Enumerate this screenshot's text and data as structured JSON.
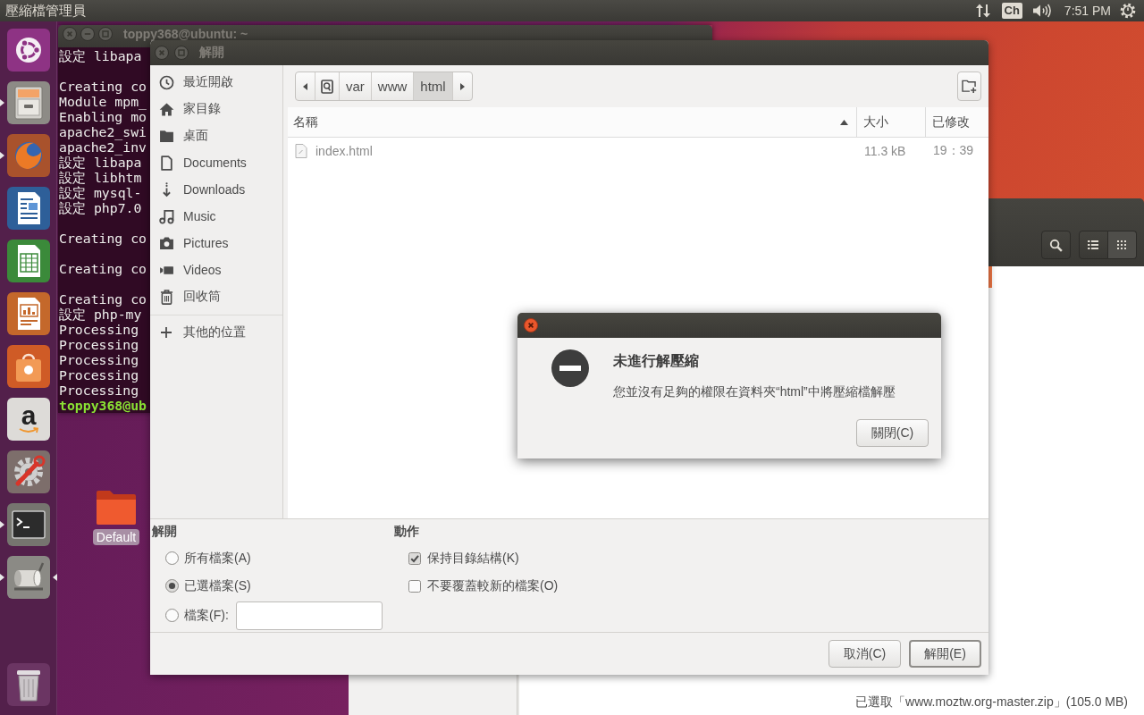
{
  "top_panel": {
    "app_title": "壓縮檔管理員",
    "keyboard_layout": "Ch",
    "clock": "7:51 PM"
  },
  "launcher": {
    "items": [
      {
        "kind": "dash",
        "running": false,
        "focused": false
      },
      {
        "kind": "files",
        "running": true,
        "focused": false
      },
      {
        "kind": "browser",
        "running": true,
        "focused": false
      },
      {
        "kind": "writer",
        "running": false,
        "focused": false
      },
      {
        "kind": "calc",
        "running": false,
        "focused": false
      },
      {
        "kind": "impress",
        "running": false,
        "focused": false
      },
      {
        "kind": "software",
        "running": false,
        "focused": false
      },
      {
        "kind": "store",
        "glyph": "a",
        "running": false,
        "focused": false
      },
      {
        "kind": "settings",
        "running": false,
        "focused": false
      },
      {
        "kind": "terminal",
        "running": true,
        "focused": false
      },
      {
        "kind": "archiver",
        "running": true,
        "focused": true
      }
    ],
    "bottom_items": [
      {
        "kind": "trash",
        "running": false,
        "focused": false
      }
    ]
  },
  "desktop_icons": [
    {
      "label": "Default"
    }
  ],
  "terminal": {
    "title": "toppy368@ubuntu: ~",
    "active": false,
    "lines": [
      {
        "kind": "output",
        "text": "設定 libapa"
      },
      {
        "kind": "blank"
      },
      {
        "kind": "output",
        "text": "Creating co"
      },
      {
        "kind": "output",
        "text": "Module mpm_"
      },
      {
        "kind": "output",
        "text": "Enabling mo"
      },
      {
        "kind": "output",
        "text": "apache2_swi"
      },
      {
        "kind": "output",
        "text": "apache2_inv"
      },
      {
        "kind": "output",
        "text": "設定 libapa"
      },
      {
        "kind": "output",
        "text": "設定 libhtm"
      },
      {
        "kind": "output",
        "text": "設定 mysql-"
      },
      {
        "kind": "output",
        "text": "設定 php7.0"
      },
      {
        "kind": "blank"
      },
      {
        "kind": "output",
        "text": "Creating co"
      },
      {
        "kind": "blank"
      },
      {
        "kind": "output",
        "text": "Creating co"
      },
      {
        "kind": "blank"
      },
      {
        "kind": "output",
        "text": "Creating co"
      },
      {
        "kind": "output",
        "text": "設定 php-my"
      },
      {
        "kind": "output",
        "text": "Processing"
      },
      {
        "kind": "output",
        "text": "Processing"
      },
      {
        "kind": "output",
        "text": "Processing"
      },
      {
        "kind": "output",
        "text": "Processing"
      },
      {
        "kind": "output",
        "text": "Processing"
      },
      {
        "kind": "prompt",
        "text": "toppy368@ub"
      }
    ]
  },
  "archive_window": {
    "view_modes": [
      {
        "kind": "list",
        "selected": false
      },
      {
        "kind": "grid",
        "selected": true
      }
    ],
    "status": "已選取「www.moztw.org-master.zip」(105.0 MB)"
  },
  "extract_dialog": {
    "title": "解開",
    "active": false,
    "places": [
      {
        "kind": "recent",
        "label": "最近開啟",
        "selected": false
      },
      {
        "kind": "home",
        "label": "家目錄",
        "selected": false
      },
      {
        "kind": "desktop",
        "label": "桌面",
        "selected": false
      },
      {
        "kind": "documents",
        "label": "Documents",
        "selected": false
      },
      {
        "kind": "downloads",
        "label": "Downloads",
        "selected": false
      },
      {
        "kind": "music",
        "label": "Music",
        "selected": false
      },
      {
        "kind": "pictures",
        "label": "Pictures",
        "selected": false
      },
      {
        "kind": "videos",
        "label": "Videos",
        "selected": false
      },
      {
        "kind": "trash",
        "label": "回收筒",
        "selected": false
      }
    ],
    "more_places": [
      {
        "kind": "other",
        "label": "其他的位置",
        "selected": false
      }
    ],
    "path": [
      {
        "kind": "root",
        "selected": false
      },
      {
        "kind": "folder",
        "label": "var",
        "selected": false
      },
      {
        "kind": "folder",
        "label": "www",
        "selected": false
      },
      {
        "kind": "folder",
        "label": "html",
        "selected": true
      }
    ],
    "columns": [
      {
        "label": "名稱",
        "sorted": true
      },
      {
        "label": "大小",
        "sorted": false
      },
      {
        "label": "已修改",
        "sorted": false
      }
    ],
    "files": [
      {
        "name": "index.html",
        "size": "11.3 kB",
        "modified": "19：39",
        "disabled": true
      }
    ],
    "extract_group": {
      "heading": "解開",
      "options": [
        {
          "kind": "radio",
          "label": "所有檔案(A)",
          "selected": false
        },
        {
          "kind": "radio",
          "label": "已選檔案(S)",
          "selected": true
        },
        {
          "kind": "radio_field",
          "label": "檔案(F):",
          "selected": false
        }
      ]
    },
    "actions_group": {
      "heading": "動作",
      "checkboxes": [
        {
          "label": "保持目錄結構(K)",
          "checked": true
        },
        {
          "label": "不要覆蓋較新的檔案(O)",
          "checked": false
        }
      ]
    },
    "buttons": [
      {
        "label": "取消(C)",
        "default": false
      },
      {
        "label": "解開(E)",
        "default": true
      }
    ]
  },
  "error_dialog": {
    "active": true,
    "heading": "未進行解壓縮",
    "message": "您並沒有足夠的權限在資料夾“html”中將壓縮檔解壓",
    "button": "關閉(C)"
  }
}
